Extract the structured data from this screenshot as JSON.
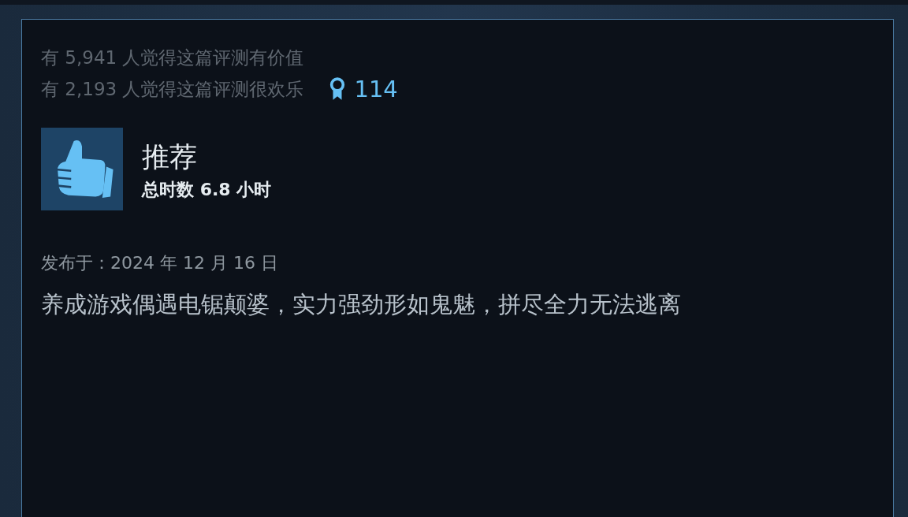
{
  "votes": {
    "helpful": "有 5,941 人觉得这篇评测有价值",
    "funny": "有 2,193 人觉得这篇评测很欢乐",
    "awards": "114"
  },
  "review": {
    "verdict": "推荐",
    "playtime": "总时数 6.8 小时",
    "posted": "发布于：2024 年 12 月 16 日",
    "body": "养成游戏偶遇电锯颠婆，实力强劲形如鬼魅，拼尽全力无法逃离"
  }
}
